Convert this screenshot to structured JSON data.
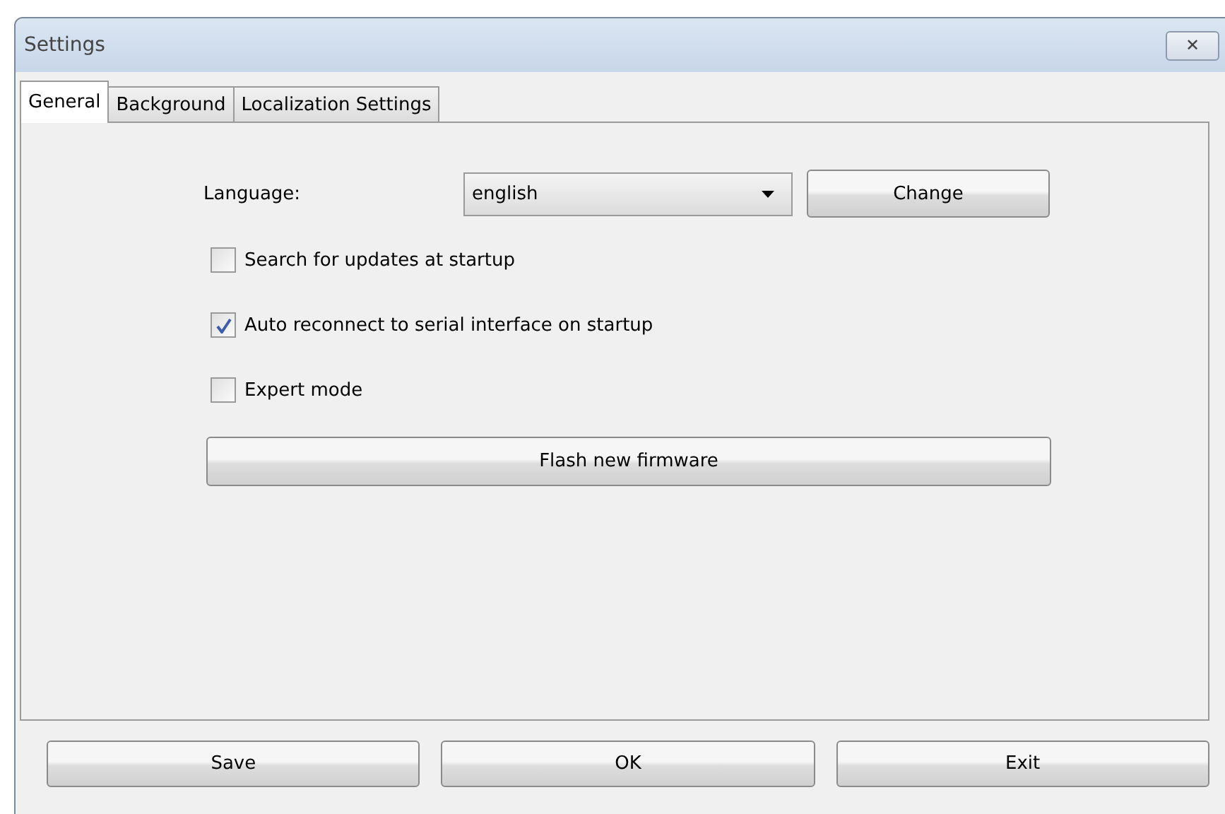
{
  "window": {
    "title": "Settings",
    "close": "✕"
  },
  "tabs": [
    {
      "label": "General",
      "selected": true
    },
    {
      "label": "Background",
      "selected": false
    },
    {
      "label": "Localization Settings",
      "selected": false
    }
  ],
  "language": {
    "label": "Language:",
    "value": "english",
    "button": "Change"
  },
  "options": [
    {
      "label": "Search for updates at startup",
      "checked": false
    },
    {
      "label": "Auto reconnect to serial interface on startup",
      "checked": true
    },
    {
      "label": "Expert mode",
      "checked": false
    }
  ],
  "flash_button": "Flash new firmware",
  "buttons": [
    "Save",
    "OK",
    "Exit"
  ]
}
